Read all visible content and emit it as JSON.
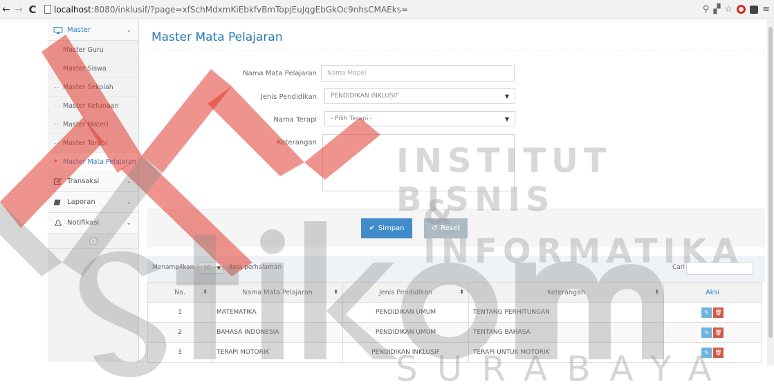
{
  "browser": {
    "url_host": "localhost",
    "url_rest": ":8080/inklusif/?page=xfSchMdxmKiEbkfvBmTopjEuJqgEbGkOc9nhsCMAEks="
  },
  "sidebar": {
    "master": "Master",
    "items": [
      "Master Guru",
      "Master Siswa",
      "Master Sekolah",
      "Master Ketunaan",
      "Master Materi",
      "Master Terapi",
      "Master Mata Pelajaran"
    ],
    "transaksi": "Transaksi",
    "laporan": "Laporan",
    "notifikasi": "Notifikasi"
  },
  "page_title": "Master Mata Pelajaran",
  "form": {
    "nama_label": "Nama Mata Pelajaran",
    "nama_placeholder": "Nama Mapel",
    "jenis_label": "Jenis Pendidikan",
    "jenis_value": "PENDIDIKAN INKLUSIF",
    "terapi_label": "Nama Terapi",
    "terapi_value": "- Pilih Terapi -",
    "keterangan_label": "Keterangan",
    "save": "Simpan",
    "reset": "Reset"
  },
  "table": {
    "show_prefix": "Menampilkan",
    "show_value": "10",
    "show_suffix": "data perhalaman",
    "search_label": "Cari",
    "headers": [
      "No.",
      "Nama Mata Pelajaran",
      "Jenis Pendidikan",
      "Keterangan",
      "Aksi"
    ],
    "rows": [
      [
        "1",
        "MATEMATIKA",
        "PENDIDIKAN UMUM",
        "TENTANG PERHITUNGAN"
      ],
      [
        "2",
        "BAHASA INDONESIA",
        "PENDIDIKAN UMUM",
        "TENTANG BAHASA"
      ],
      [
        "3",
        "TERAPI MOTORIK",
        "PENDIDIKAN INKLUSIF",
        "TERAPI UNTUK MOTORIK"
      ]
    ]
  },
  "watermark": {
    "line1": "INSTITUT BISNIS",
    "line2": "& INFORMATIKA",
    "logo": "stikom",
    "line3": "SURABAYA"
  },
  "colors": {
    "accent": "#2679b5",
    "watermark_red": "#e03a2f",
    "watermark_grey": "#8a8a8a"
  }
}
